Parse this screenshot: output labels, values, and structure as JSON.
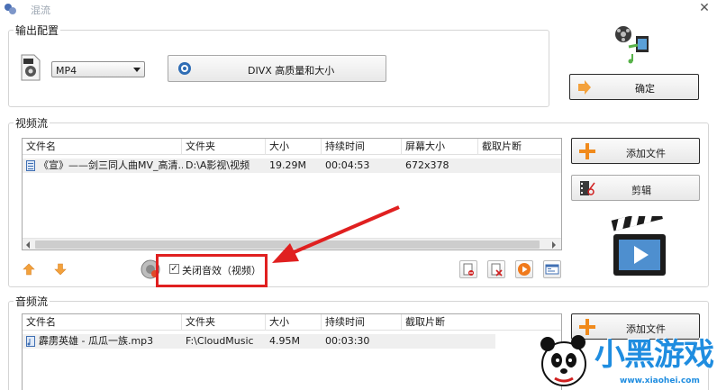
{
  "window": {
    "title": "混流",
    "close_glyph": "✕"
  },
  "output_config": {
    "group_label": "输出配置",
    "format_value": "MP4",
    "preset_label": "DIVX 高质量和大小",
    "confirm_label": "确定"
  },
  "video_stream": {
    "group_label": "视频流",
    "columns": [
      "文件名",
      "文件夹",
      "大小",
      "持续时间",
      "屏幕大小",
      "截取片断"
    ],
    "rows": [
      {
        "name": "《宣》——剑三同人曲MV_高清...",
        "folder": "D:\\A影视\\视频",
        "size": "19.29M",
        "duration": "00:04:53",
        "screen_size": "672x378",
        "clip": ""
      }
    ],
    "add_file_label": "添加文件",
    "edit_label": "剪辑",
    "mute_label": "关闭音效（视频）",
    "mute_checked": true
  },
  "audio_stream": {
    "group_label": "音频流",
    "columns": [
      "文件名",
      "文件夹",
      "大小",
      "持续时间",
      "截取片断"
    ],
    "rows": [
      {
        "name": "霹雳英雄 - 瓜瓜一族.mp3",
        "folder": "F:\\CloudMusic",
        "size": "4.95M",
        "duration": "00:03:30",
        "clip": ""
      }
    ],
    "add_file_label": "添加文件"
  },
  "watermark": {
    "brand": "小黑游戏",
    "url": "www.xiaohei.com"
  },
  "colors": {
    "annotation_red": "#e02020",
    "orange_arrow": "#f3a13c",
    "plus_orange": "#f08a1c"
  }
}
